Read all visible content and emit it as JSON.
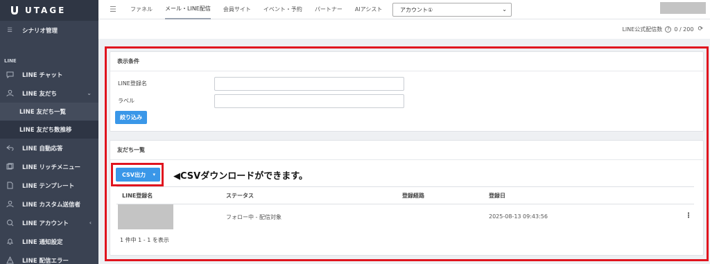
{
  "brand": {
    "name": "UTAGE"
  },
  "sidebar": {
    "scenario": "シナリオ管理",
    "section_line": "LINE",
    "items": [
      {
        "label": "LINE チャット",
        "icon": "chat-icon"
      },
      {
        "label": "LINE 友だち",
        "icon": "person-icon",
        "expanded": true
      },
      {
        "label": "LINE 友だち一覧",
        "sub": true,
        "active": true
      },
      {
        "label": "LINE 友だち数推移",
        "sub": true
      },
      {
        "label": "LINE 自動応答",
        "icon": "reply-icon"
      },
      {
        "label": "LINE リッチメニュー",
        "icon": "menu-icon"
      },
      {
        "label": "LINE テンプレート",
        "icon": "template-icon"
      },
      {
        "label": "LINE カスタム送信者",
        "icon": "sender-icon"
      },
      {
        "label": "LINE アカウント",
        "icon": "account-icon"
      },
      {
        "label": "LINE 通知設定",
        "icon": "bell-icon"
      },
      {
        "label": "LINE 配信エラー",
        "icon": "warning-icon"
      }
    ]
  },
  "topnav": {
    "tabs": [
      "ファネル",
      "メール・LINE配信",
      "会員サイト",
      "イベント・予約",
      "パートナー",
      "AIアシスト"
    ],
    "active_tab": "メール・LINE配信",
    "account_select": "アカウント①"
  },
  "count_bar": {
    "label": "LINE公式配信数",
    "value": "0 / 200"
  },
  "filter": {
    "title": "表示条件",
    "name_label": "LINE登録名",
    "label_label": "ラベル",
    "button": "絞り込み"
  },
  "list": {
    "title": "友だち一覧",
    "csv_button": "CSV出力",
    "annotation": "◀CSVダウンロードができます。",
    "columns": [
      "LINE登録名",
      "ステータス",
      "登録経路",
      "登録日"
    ],
    "rows": [
      {
        "name": "",
        "status": "フォロー中 - 配信対象",
        "route": "",
        "date": "2025-08-13 09:43:56"
      }
    ],
    "summary": "1 件中 1 - 1 を表示"
  },
  "colors": {
    "accent": "#3a97e8",
    "highlight": "#e0141e",
    "sidebar": "#3a4252"
  }
}
